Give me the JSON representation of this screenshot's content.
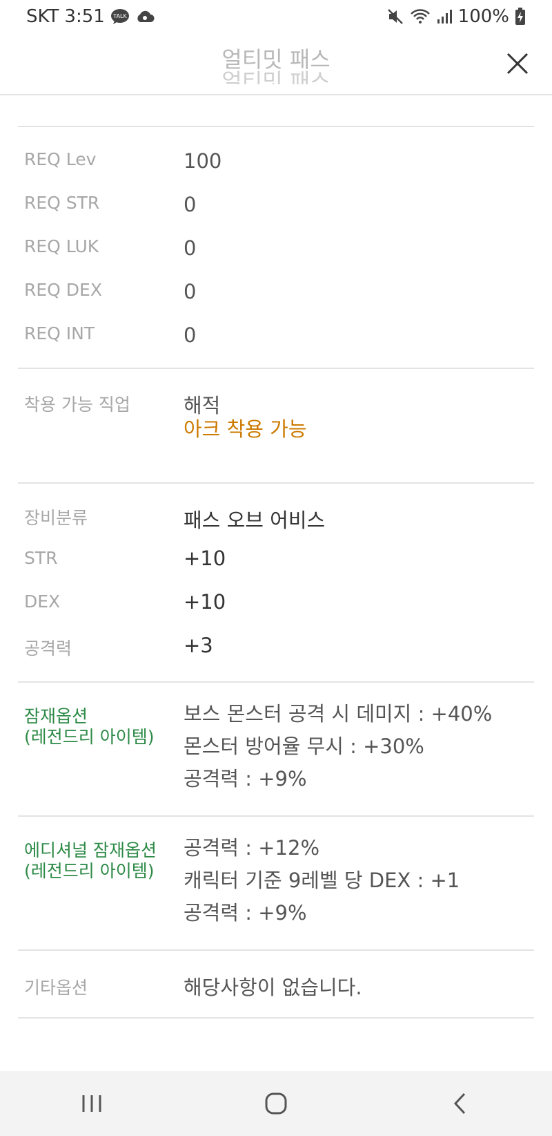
{
  "status": {
    "carrier": "SKT",
    "time": "3:51",
    "battery": "100%",
    "icons": [
      "talk-icon",
      "cloud-icon",
      "mute-icon",
      "wifi-icon",
      "signal-icon",
      "battery-charging-icon"
    ]
  },
  "header": {
    "title": "얼티밋 패스",
    "title_ghost": "얼티밋 패스"
  },
  "requirements": [
    {
      "label": "REQ Lev",
      "value": "100"
    },
    {
      "label": "REQ STR",
      "value": "0"
    },
    {
      "label": "REQ LUK",
      "value": "0"
    },
    {
      "label": "REQ DEX",
      "value": "0"
    },
    {
      "label": "REQ INT",
      "value": "0"
    }
  ],
  "job": {
    "label": "착용 가능 직업",
    "value": "해적",
    "note": "아크 착용 가능",
    "note_color": "#cc7a00"
  },
  "stats": [
    {
      "label": "장비분류",
      "value": "패스 오브 어비스"
    },
    {
      "label": "STR",
      "value": "+10"
    },
    {
      "label": "DEX",
      "value": "+10"
    },
    {
      "label": "공격력",
      "value": "+3"
    }
  ],
  "potential": {
    "label_line1": "잠재옵션",
    "label_line2": "(레전드리 아이템)",
    "label_color": "#2d8a47",
    "lines": [
      "보스 몬스터 공격 시 데미지 : +40%",
      "몬스터 방어율 무시 : +30%",
      "공격력 : +9%"
    ]
  },
  "additional_potential": {
    "label_line1": "에디셔널 잠재옵션",
    "label_line2": "(레전드리 아이템)",
    "lines": [
      "공격력 : +12%",
      "캐릭터 기준 9레벨 당 DEX : +1",
      "공격력 : +9%"
    ]
  },
  "other": {
    "label": "기타옵션",
    "value": "해당사항이 없습니다."
  },
  "nav": {
    "icons": [
      "recent-apps-icon",
      "home-icon",
      "back-icon"
    ]
  }
}
